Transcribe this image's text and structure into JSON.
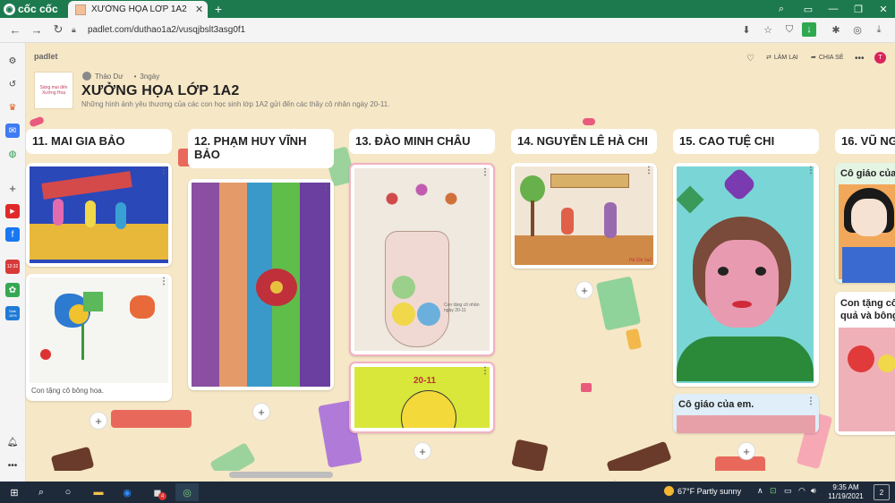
{
  "browser": {
    "brand": "cốc cốc",
    "tab_title": "XƯỞNG HỌA LỚP 1A2",
    "url": "padlet.com/duthao1a2/vusqjbslt3asg0f1"
  },
  "padlet": {
    "brand": "padlet",
    "thumb_text": "Sáng mai đến Xưởng Hoạ",
    "author": "Thảo Dư",
    "time_ago": "3ngày",
    "title": "XƯỞNG HỌA LỚP 1A2",
    "description": "Những hình ảnh yêu thương của các con học sinh lớp 1A2 gửi đến các thầy cô nhân ngày 20-11.",
    "toolbar": {
      "remake": "LÀM LẠI",
      "share": "CHIA SẺ",
      "avatar": "T"
    }
  },
  "columns": [
    {
      "title": "11. MAI GIA BẢO",
      "captions": [
        "Con tặng cô bông hoa."
      ]
    },
    {
      "title": "12. PHẠM HUY VĨNH BẢO"
    },
    {
      "title": "13. ĐÀO MINH CHÂU",
      "art_text": [
        "Con tặng cô nhân ngày 20-11",
        "20-11"
      ]
    },
    {
      "title": "14. NGUYỄN LÊ HÀ CHI",
      "art_text": [
        "Hà Chi 1a2"
      ]
    },
    {
      "title": "15. CAO TUỆ CHI",
      "cards": [
        "Cô giáo của em."
      ]
    },
    {
      "title": "16. VŨ NG",
      "cards": [
        "Cô giáo của",
        "Con tặng cô quả và bông"
      ]
    }
  ],
  "taskbar": {
    "weather": "67°F  Partly sunny",
    "time": "9:35 AM",
    "date": "11/19/2021",
    "notif_badge": "2",
    "zoom_badge": "4"
  },
  "sidebar_badges": {
    "calendar": "12:32",
    "sale": "Sale -50%"
  },
  "icons": [
    "settings-icon",
    "history-icon",
    "crown-icon",
    "messenger-icon",
    "game-icon",
    "plus-icon",
    "youtube-icon",
    "facebook-icon",
    "calendar-icon",
    "gift-icon",
    "sale-icon",
    "bell-icon",
    "more-icon"
  ]
}
